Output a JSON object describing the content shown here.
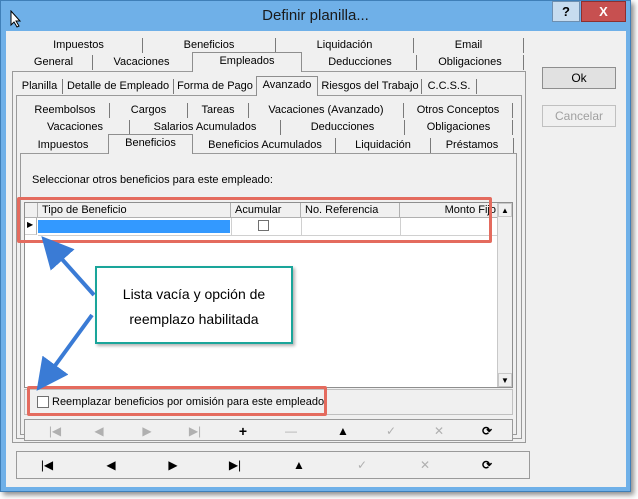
{
  "window": {
    "title": "Definir planilla...",
    "help_label": "?",
    "close_label": "X"
  },
  "tabs_row1a": [
    "Impuestos",
    "Beneficios",
    "Liquidación",
    "Email"
  ],
  "tabs_row1b": [
    "General",
    "Vacaciones",
    "Empleados",
    "Deducciones",
    "Obligaciones"
  ],
  "tabs_row2": [
    "Planilla",
    "Detalle de Empleado",
    "Forma de Pago",
    "Avanzado",
    "Riesgos del Trabajo",
    "C.C.S.S."
  ],
  "tabs_row3a": [
    "Reembolsos",
    "Cargos",
    "Tareas",
    "Vacaciones (Avanzado)",
    "Otros Conceptos"
  ],
  "tabs_row3b": [
    "Vacaciones",
    "Salarios Acumulados",
    "Deducciones",
    "Obligaciones"
  ],
  "tabs_row3c": [
    "Impuestos",
    "Beneficios",
    "Beneficios Acumulados",
    "Liquidación",
    "Préstamos"
  ],
  "panel": {
    "instruction": "Seleccionar otros beneficios para este empleado:"
  },
  "grid": {
    "columns": [
      "Tipo de Beneficio",
      "Acumular",
      "No. Referencia",
      "Monto Fijo"
    ],
    "row_indicator": "▶",
    "scroll_up": "▲",
    "scroll_down": "▼"
  },
  "replace_option": {
    "label": "Reemplazar beneficios por omisión para este empleado",
    "checked": false
  },
  "inner_nav": [
    "|◀",
    "◀",
    "▶",
    "▶|",
    "+",
    "—",
    "▲",
    "✓",
    "✕",
    "⟳"
  ],
  "outer_nav": [
    "|◀",
    "◀",
    "▶",
    "▶|",
    "▲",
    "✓",
    "✕",
    "⟳"
  ],
  "side_buttons": {
    "ok": "Ok",
    "cancel": "Cancelar"
  },
  "callout": {
    "line1": "Lista vacía y opción de",
    "line2": "reemplazo habilitada"
  },
  "colors": {
    "annotation_red": "#e46b5e",
    "callout_border": "#1aa59a",
    "arrow_blue": "#3a7bd5",
    "selection_blue": "#3399ff"
  }
}
